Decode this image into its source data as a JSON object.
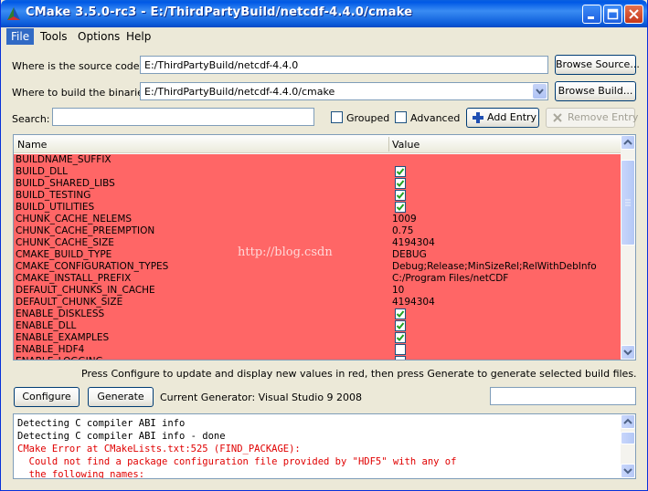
{
  "window": {
    "title": "CMake 3.5.0-rc3 - E:/ThirdPartyBuild/netcdf-4.4.0/cmake"
  },
  "menu": [
    "File",
    "Tools",
    "Options",
    "Help"
  ],
  "source": {
    "label": "Where is the source code:",
    "value": "E:/ThirdPartyBuild/netcdf-4.4.0",
    "browse_label": "Browse Source..."
  },
  "build": {
    "label": "Where to build the binaries:",
    "value": "E:/ThirdPartyBuild/netcdf-4.4.0/cmake",
    "browse_label": "Browse Build..."
  },
  "search": {
    "label": "Search:",
    "value": "",
    "grouped_label": "Grouped",
    "advanced_label": "Advanced",
    "add_entry_label": "Add Entry",
    "remove_entry_label": "Remove Entry"
  },
  "table": {
    "columns": [
      "Name",
      "Value"
    ],
    "rows": [
      {
        "name": "BUILDNAME_SUFFIX",
        "value": "",
        "type": "text"
      },
      {
        "name": "BUILD_DLL",
        "value": "",
        "type": "check",
        "checked": true
      },
      {
        "name": "BUILD_SHARED_LIBS",
        "value": "",
        "type": "check",
        "checked": true
      },
      {
        "name": "BUILD_TESTING",
        "value": "",
        "type": "check",
        "checked": true
      },
      {
        "name": "BUILD_UTILITIES",
        "value": "",
        "type": "check",
        "checked": true
      },
      {
        "name": "CHUNK_CACHE_NELEMS",
        "value": "1009",
        "type": "text"
      },
      {
        "name": "CHUNK_CACHE_PREEMPTION",
        "value": "0.75",
        "type": "text"
      },
      {
        "name": "CHUNK_CACHE_SIZE",
        "value": "4194304",
        "type": "text"
      },
      {
        "name": "CMAKE_BUILD_TYPE",
        "value": "DEBUG",
        "type": "text"
      },
      {
        "name": "CMAKE_CONFIGURATION_TYPES",
        "value": "Debug;Release;MinSizeRel;RelWithDebInfo",
        "type": "text"
      },
      {
        "name": "CMAKE_INSTALL_PREFIX",
        "value": "C:/Program Files/netCDF",
        "type": "text"
      },
      {
        "name": "DEFAULT_CHUNKS_IN_CACHE",
        "value": "10",
        "type": "text"
      },
      {
        "name": "DEFAULT_CHUNK_SIZE",
        "value": "4194304",
        "type": "text"
      },
      {
        "name": "ENABLE_DISKLESS",
        "value": "",
        "type": "check",
        "checked": true
      },
      {
        "name": "ENABLE_DLL",
        "value": "",
        "type": "check",
        "checked": true
      },
      {
        "name": "ENABLE_EXAMPLES",
        "value": "",
        "type": "check",
        "checked": true
      },
      {
        "name": "ENABLE_HDF4",
        "value": "",
        "type": "check",
        "checked": false
      },
      {
        "name": "ENABLE_LOGGING",
        "value": "",
        "type": "check",
        "checked": false
      }
    ],
    "watermark": "http://blog.csdn"
  },
  "status_message": "Press Configure to update and display new values in red, then press Generate to generate selected build files.",
  "actions": {
    "configure_label": "Configure",
    "generate_label": "Generate",
    "generator_text": "Current Generator: Visual Studio 9 2008",
    "filter_value": ""
  },
  "output": {
    "lines": [
      {
        "text": "Detecting C compiler ABI info",
        "error": false
      },
      {
        "text": "Detecting C compiler ABI info - done",
        "error": false
      },
      {
        "text": "CMake Error at CMakeLists.txt:525 (FIND_PACKAGE):",
        "error": true
      },
      {
        "text": "  Could not find a package configuration file provided by \"HDF5\" with any of",
        "error": true
      },
      {
        "text": "  the following names:",
        "error": true
      }
    ]
  },
  "colors": {
    "title_bar": "#0058e6",
    "new_value_row": "#ff6666",
    "error_text": "#e00000"
  }
}
